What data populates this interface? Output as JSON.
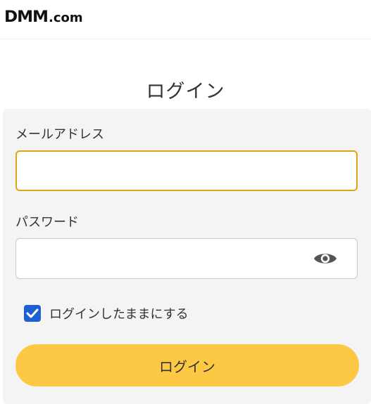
{
  "header": {
    "logo_main": "DMM",
    "logo_suffix": ".com"
  },
  "page": {
    "title": "ログイン"
  },
  "form": {
    "email_label": "メールアドレス",
    "email_value": "",
    "email_placeholder": "",
    "password_label": "パスワード",
    "password_value": "",
    "password_placeholder": "",
    "password_toggle_icon": "eye-icon",
    "remember_label": "ログインしたままにする",
    "remember_checked": true,
    "submit_label": "ログイン"
  },
  "colors": {
    "accent": "#fdc844",
    "focus_border": "#e0a412",
    "checkbox": "#1d5fd1",
    "card_bg": "#f4f4f4"
  }
}
